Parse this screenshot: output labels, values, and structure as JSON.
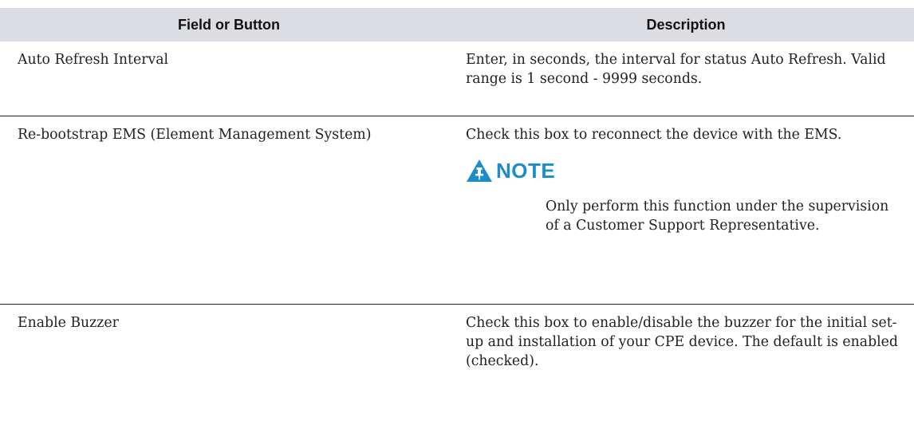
{
  "table": {
    "headers": {
      "field": "Field or Button",
      "description": "Description"
    },
    "rows": [
      {
        "field": "Auto Refresh Interval",
        "description": "Enter, in seconds, the interval for status Auto Refresh. Valid range is 1 second - 9999 seconds."
      },
      {
        "field": "Re-bootstrap EMS (Element Management System)",
        "description": "Check this box to reconnect the device with the EMS.",
        "note": {
          "label": "NOTE",
          "icon": "warning-pin-icon",
          "color": "#1b8dc8",
          "text": "Only perform this function under the supervision of a Customer Support Representative."
        }
      },
      {
        "field": "Enable Buzzer",
        "description": "Check this box to enable/disable the buzzer for the initial set-up and installation of your CPE device.  The default is enabled (checked)."
      }
    ]
  }
}
